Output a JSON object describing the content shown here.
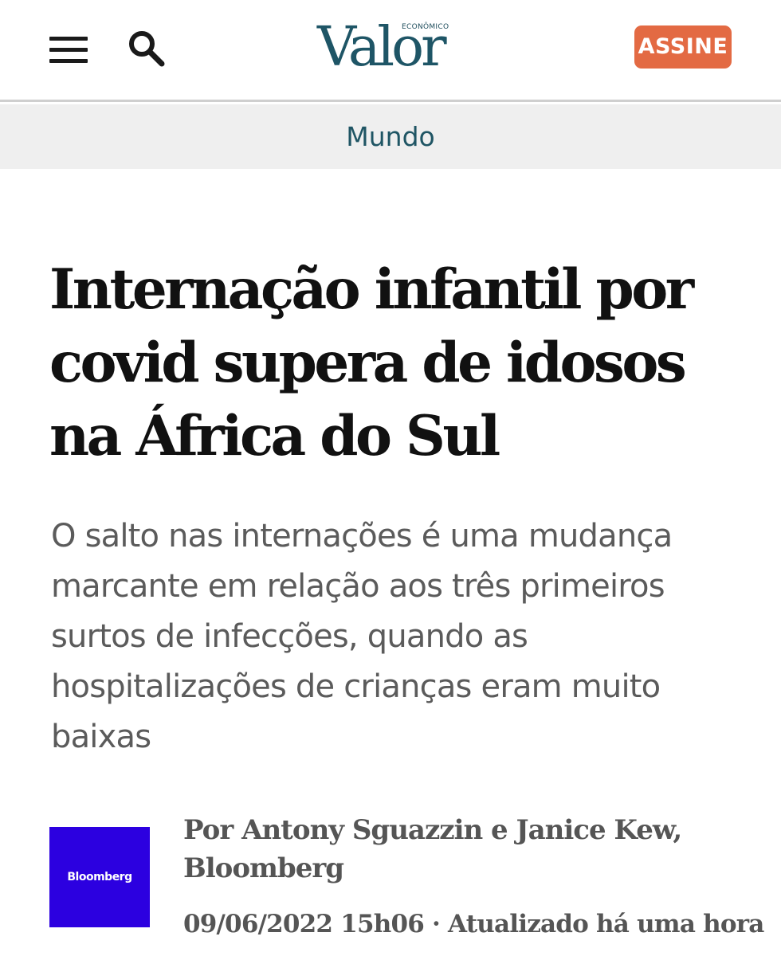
{
  "header": {
    "logo_small": "ECONÔMICO",
    "logo_main": "Valor",
    "subscribe_label": "ASSINE",
    "menu_icon": "hamburger-menu-icon",
    "search_icon": "search-icon"
  },
  "section": {
    "label": "Mundo"
  },
  "article": {
    "headline": "Internação infantil por covid supera de idosos na África do Sul",
    "subheadline": "O salto nas internações é uma mudança marcante em relação aos três primeiros surtos de infecções, quando as hospitalizações de crianças eram muito baixas",
    "source_logo_text": "Bloomberg",
    "byline": "Por Antony Sguazzin e Janice Kew, Bloomberg",
    "date": "09/06/2022 15h06",
    "separator": "·",
    "updated": "Atualizado há uma hora"
  },
  "colors": {
    "brand": "#1e5566",
    "subscribe": "#e36a43",
    "section_bar": "#efefef",
    "bloomberg": "#2c00e0"
  }
}
